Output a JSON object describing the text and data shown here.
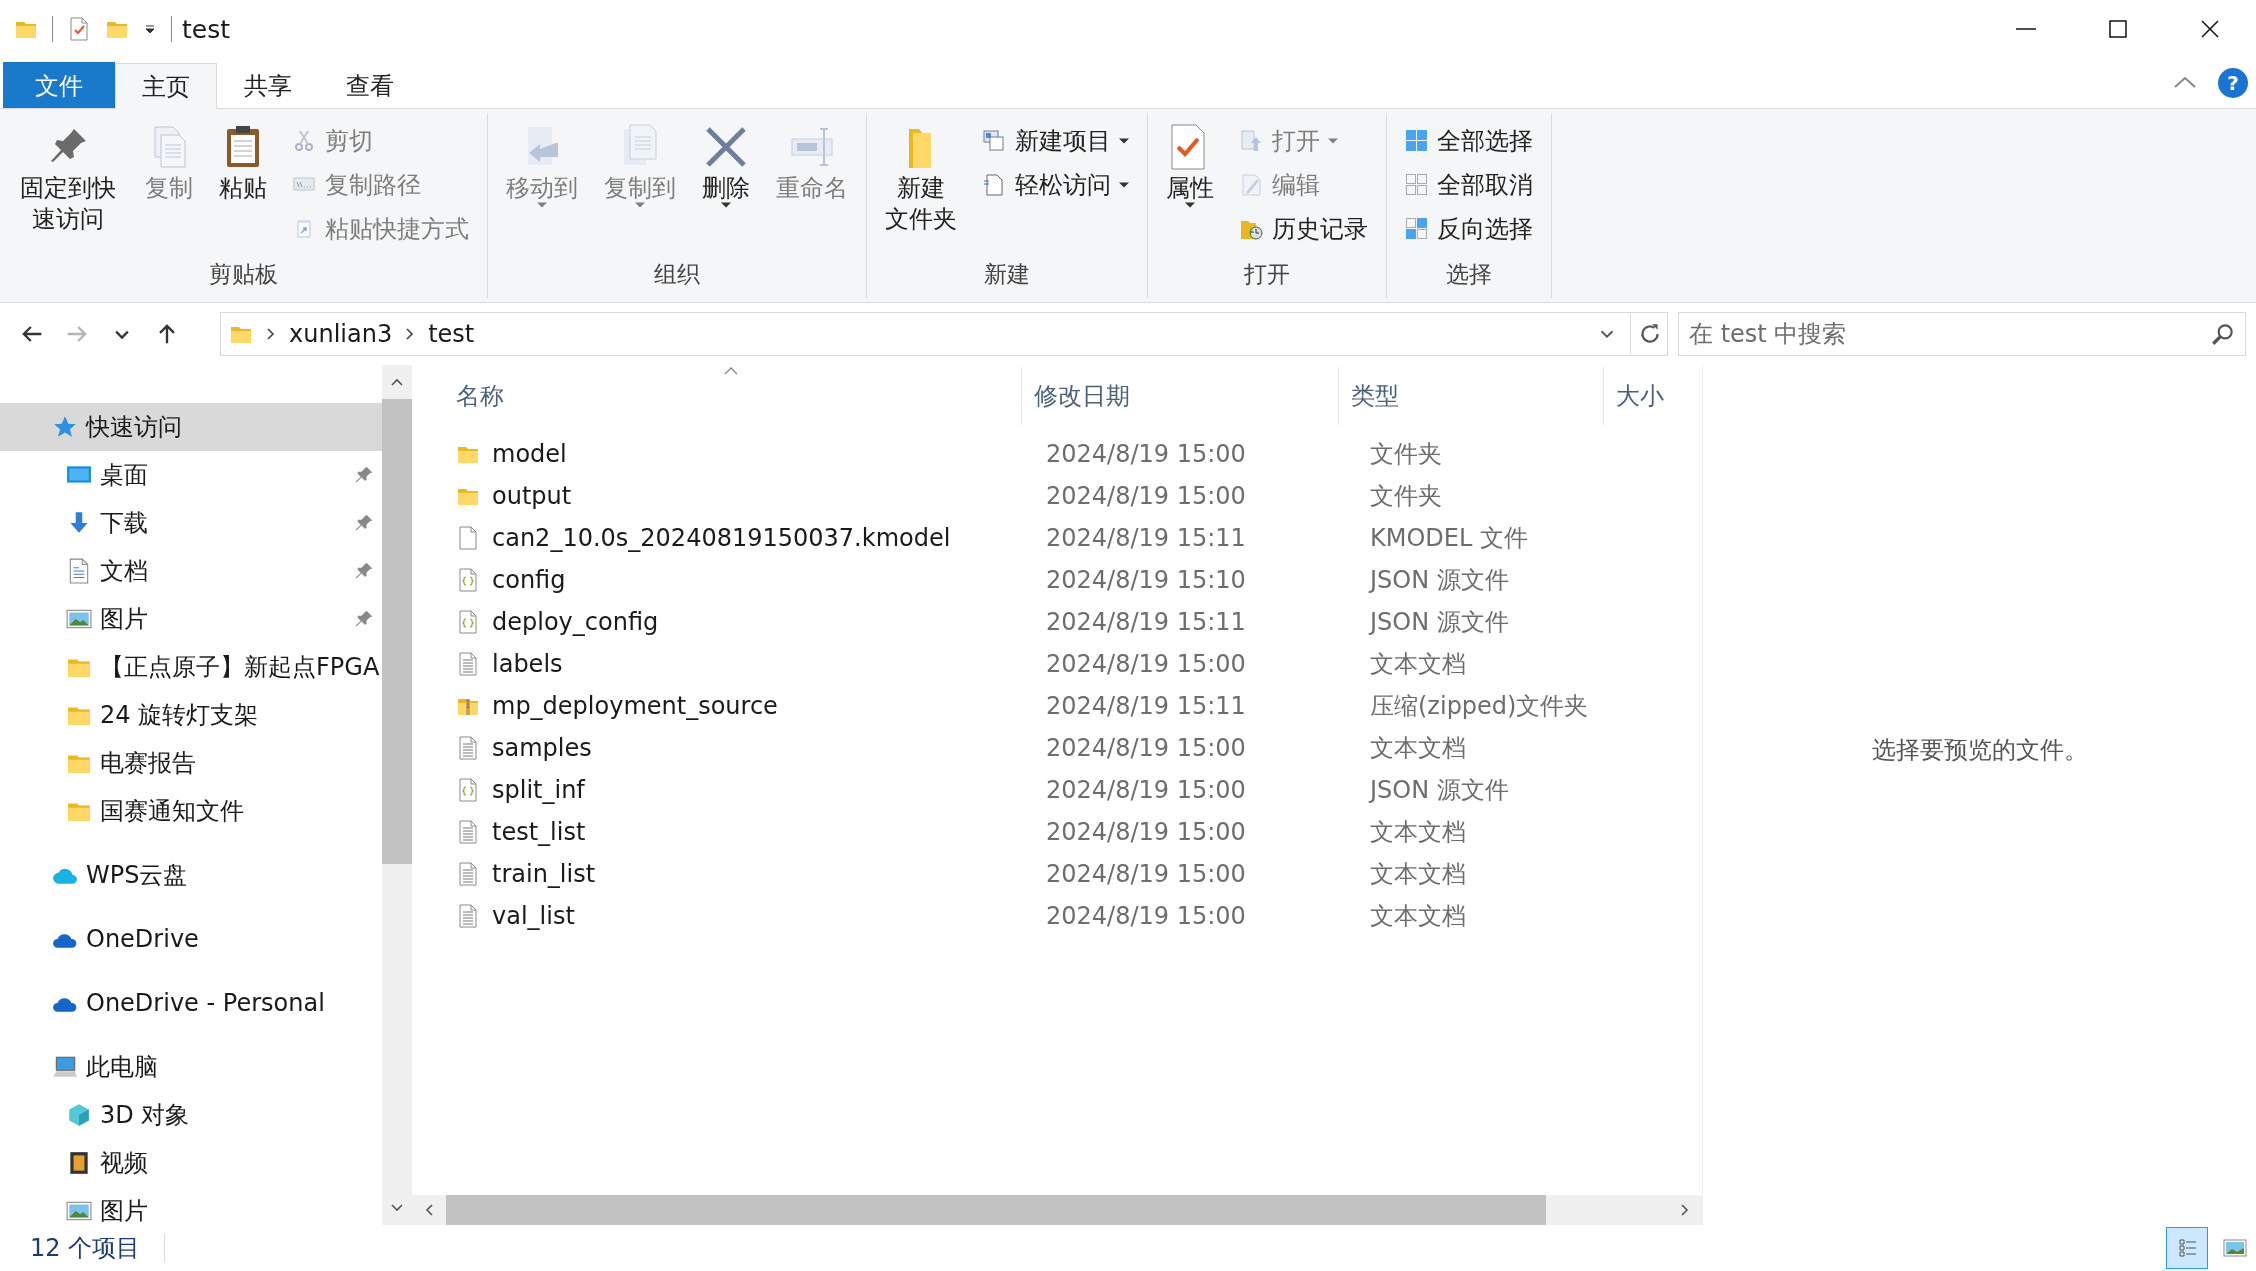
{
  "window": {
    "title": "test"
  },
  "ribbon_tabs": [
    {
      "label": "文件",
      "kind": "file",
      "selected": false
    },
    {
      "label": "主页",
      "kind": "tab",
      "selected": true
    },
    {
      "label": "共享",
      "kind": "tab",
      "selected": false
    },
    {
      "label": "查看",
      "kind": "tab",
      "selected": false
    }
  ],
  "help_button": {
    "label": "?"
  },
  "ribbon_groups": [
    {
      "label": "剪贴板",
      "columns": [
        [
          {
            "label": "固定到快速访问",
            "kind": "large",
            "disabled": false
          }
        ],
        [
          {
            "label": "复制",
            "kind": "large",
            "disabled": true
          }
        ],
        [
          {
            "label": "粘贴",
            "kind": "large",
            "disabled": false
          }
        ],
        [
          {
            "label": "剪切",
            "kind": "small",
            "disabled": true
          },
          {
            "label": "复制路径",
            "kind": "small",
            "disabled": true
          },
          {
            "label": "粘贴快捷方式",
            "kind": "small",
            "disabled": true
          }
        ]
      ]
    },
    {
      "label": "组织",
      "columns": [
        [
          {
            "label": "移动到",
            "kind": "large",
            "disabled": true,
            "dropdown": true
          }
        ],
        [
          {
            "label": "复制到",
            "kind": "large",
            "disabled": true,
            "dropdown": true
          }
        ],
        [
          {
            "label": "删除",
            "kind": "large",
            "disabled": false,
            "dropdown": true
          }
        ],
        [
          {
            "label": "重命名",
            "kind": "large",
            "disabled": true
          }
        ]
      ]
    },
    {
      "label": "新建",
      "columns": [
        [
          {
            "lines": [
              "新建",
              "文件夹"
            ],
            "kind": "large",
            "disabled": false
          }
        ],
        [
          {
            "label": "新建项目",
            "kind": "small",
            "disabled": false,
            "dropdown": true
          },
          {
            "label": "轻松访问",
            "kind": "small",
            "disabled": false,
            "dropdown": true
          }
        ]
      ]
    },
    {
      "label": "打开",
      "columns": [
        [
          {
            "label": "属性",
            "kind": "large",
            "disabled": false,
            "dropdown": true
          }
        ],
        [
          {
            "label": "打开",
            "kind": "small",
            "disabled": true,
            "dropdown": true
          },
          {
            "label": "编辑",
            "kind": "small",
            "disabled": true
          },
          {
            "label": "历史记录",
            "kind": "small",
            "disabled": false
          }
        ]
      ]
    },
    {
      "label": "选择",
      "columns": [
        [
          {
            "label": "全部选择",
            "kind": "small",
            "disabled": false
          },
          {
            "label": "全部取消",
            "kind": "small",
            "disabled": false
          },
          {
            "label": "反向选择",
            "kind": "small",
            "disabled": false
          }
        ]
      ]
    }
  ],
  "nav_buttons": [
    {
      "kind": "back",
      "disabled": false
    },
    {
      "kind": "forward",
      "disabled": true
    },
    {
      "kind": "recent",
      "disabled": false
    },
    {
      "kind": "up",
      "disabled": false
    }
  ],
  "address": {
    "breadcrumbs": [
      "xunlian3",
      "test"
    ]
  },
  "search": {
    "placeholder": "在 test 中搜索"
  },
  "sidebar": {
    "items": [
      {
        "label": "快速访问",
        "kind": "quick",
        "selected": true,
        "children": [
          {
            "label": "桌面",
            "kind": "desktop",
            "selected": false,
            "pinned": true
          },
          {
            "label": "下载",
            "kind": "downloads",
            "selected": false,
            "pinned": true
          },
          {
            "label": "文档",
            "kind": "documents",
            "selected": false,
            "pinned": true
          },
          {
            "label": "图片",
            "kind": "pictures",
            "selected": false,
            "pinned": true
          },
          {
            "label": "【正点原子】新起点FPGA",
            "kind": "folder",
            "selected": false,
            "pinned": false
          },
          {
            "label": "24 旋转灯支架",
            "kind": "folder",
            "selected": false,
            "pinned": false
          },
          {
            "label": "电赛报告",
            "kind": "folder",
            "selected": false,
            "pinned": false
          },
          {
            "label": "国赛通知文件",
            "kind": "folder",
            "selected": false,
            "pinned": false
          }
        ]
      },
      {
        "label": "WPS云盘",
        "kind": "wps",
        "selected": false
      },
      {
        "label": "OneDrive",
        "kind": "onedrive",
        "selected": false
      },
      {
        "label": "OneDrive - Personal",
        "kind": "onedrive",
        "selected": false
      },
      {
        "label": "此电脑",
        "kind": "pc",
        "selected": false,
        "children": [
          {
            "label": "3D 对象",
            "kind": "cube",
            "selected": false,
            "pinned": false
          },
          {
            "label": "视频",
            "kind": "videos",
            "selected": false,
            "pinned": false
          },
          {
            "label": "图片",
            "kind": "pictures",
            "selected": false,
            "pinned": false
          }
        ]
      }
    ]
  },
  "table": {
    "columns": [
      {
        "label": "名称",
        "sorted": true
      },
      {
        "label": "修改日期",
        "sorted": false
      },
      {
        "label": "类型",
        "sorted": false
      },
      {
        "label": "大小",
        "sorted": false
      }
    ],
    "rows": [
      {
        "name": "model",
        "date": "2024/8/19 15:00",
        "type": "文件夹",
        "kind": "folder"
      },
      {
        "name": "output",
        "date": "2024/8/19 15:00",
        "type": "文件夹",
        "kind": "folder"
      },
      {
        "name": "can2_10.0s_20240819150037.kmodel",
        "date": "2024/8/19 15:11",
        "type": "KMODEL 文件",
        "kind": "file"
      },
      {
        "name": "config",
        "date": "2024/8/19 15:10",
        "type": "JSON 源文件",
        "kind": "json"
      },
      {
        "name": "deploy_config",
        "date": "2024/8/19 15:11",
        "type": "JSON 源文件",
        "kind": "json"
      },
      {
        "name": "labels",
        "date": "2024/8/19 15:00",
        "type": "文本文档",
        "kind": "text"
      },
      {
        "name": "mp_deployment_source",
        "date": "2024/8/19 15:11",
        "type": "压缩(zipped)文件夹",
        "kind": "zip"
      },
      {
        "name": "samples",
        "date": "2024/8/19 15:00",
        "type": "文本文档",
        "kind": "text"
      },
      {
        "name": "split_inf",
        "date": "2024/8/19 15:00",
        "type": "JSON 源文件",
        "kind": "json"
      },
      {
        "name": "test_list",
        "date": "2024/8/19 15:00",
        "type": "文本文档",
        "kind": "text"
      },
      {
        "name": "train_list",
        "date": "2024/8/19 15:00",
        "type": "文本文档",
        "kind": "text"
      },
      {
        "name": "val_list",
        "date": "2024/8/19 15:00",
        "type": "文本文档",
        "kind": "text"
      }
    ]
  },
  "preview": {
    "message": "选择要预览的文件。"
  },
  "status_bar": {
    "count": "12 个项目",
    "view_buttons": [
      {
        "kind": "details",
        "selected": true
      },
      {
        "kind": "large_icons",
        "selected": false
      }
    ]
  }
}
